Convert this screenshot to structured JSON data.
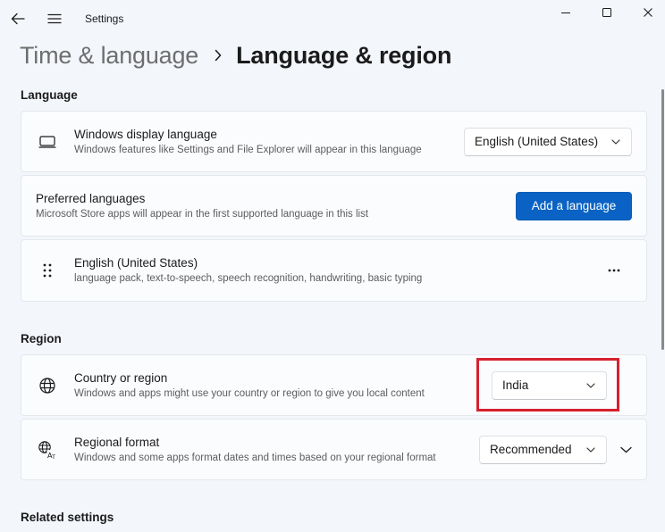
{
  "window": {
    "title": "Settings",
    "controls": [
      "minimize-icon",
      "maximize-icon",
      "close-icon"
    ]
  },
  "toolbar": {
    "back_icon": "back-arrow-icon",
    "menu_icon": "hamburger-menu-icon"
  },
  "breadcrumb": {
    "parent": "Time & language",
    "separator_icon": "chevron-right-icon",
    "current": "Language & region"
  },
  "language_section": {
    "title": "Language",
    "display_language": {
      "icon": "monitor-icon",
      "title": "Windows display language",
      "subtitle": "Windows features like Settings and File Explorer will appear in this language",
      "value": "English (United States)"
    },
    "preferred_languages": {
      "title": "Preferred languages",
      "subtitle": "Microsoft Store apps will appear in the first supported language in this list",
      "button": "Add a language"
    },
    "language_item": {
      "icon": "drag-handle-icon",
      "title": "English (United States)",
      "subtitle": "language pack, text-to-speech, speech recognition, handwriting, basic typing",
      "more_icon": "more-options-icon"
    }
  },
  "region_section": {
    "title": "Region",
    "country": {
      "icon": "globe-icon",
      "title": "Country or region",
      "subtitle": "Windows and apps might use your country or region to give you local content",
      "value": "India"
    },
    "regional_format": {
      "icon": "regional-format-icon",
      "title": "Regional format",
      "subtitle": "Windows and some apps format dates and times based on your regional format",
      "value": "Recommended"
    }
  },
  "related_settings": {
    "title": "Related settings"
  },
  "colors": {
    "accent": "#0a63c4",
    "highlight": "#d6212e",
    "background": "#f3f6fb"
  }
}
